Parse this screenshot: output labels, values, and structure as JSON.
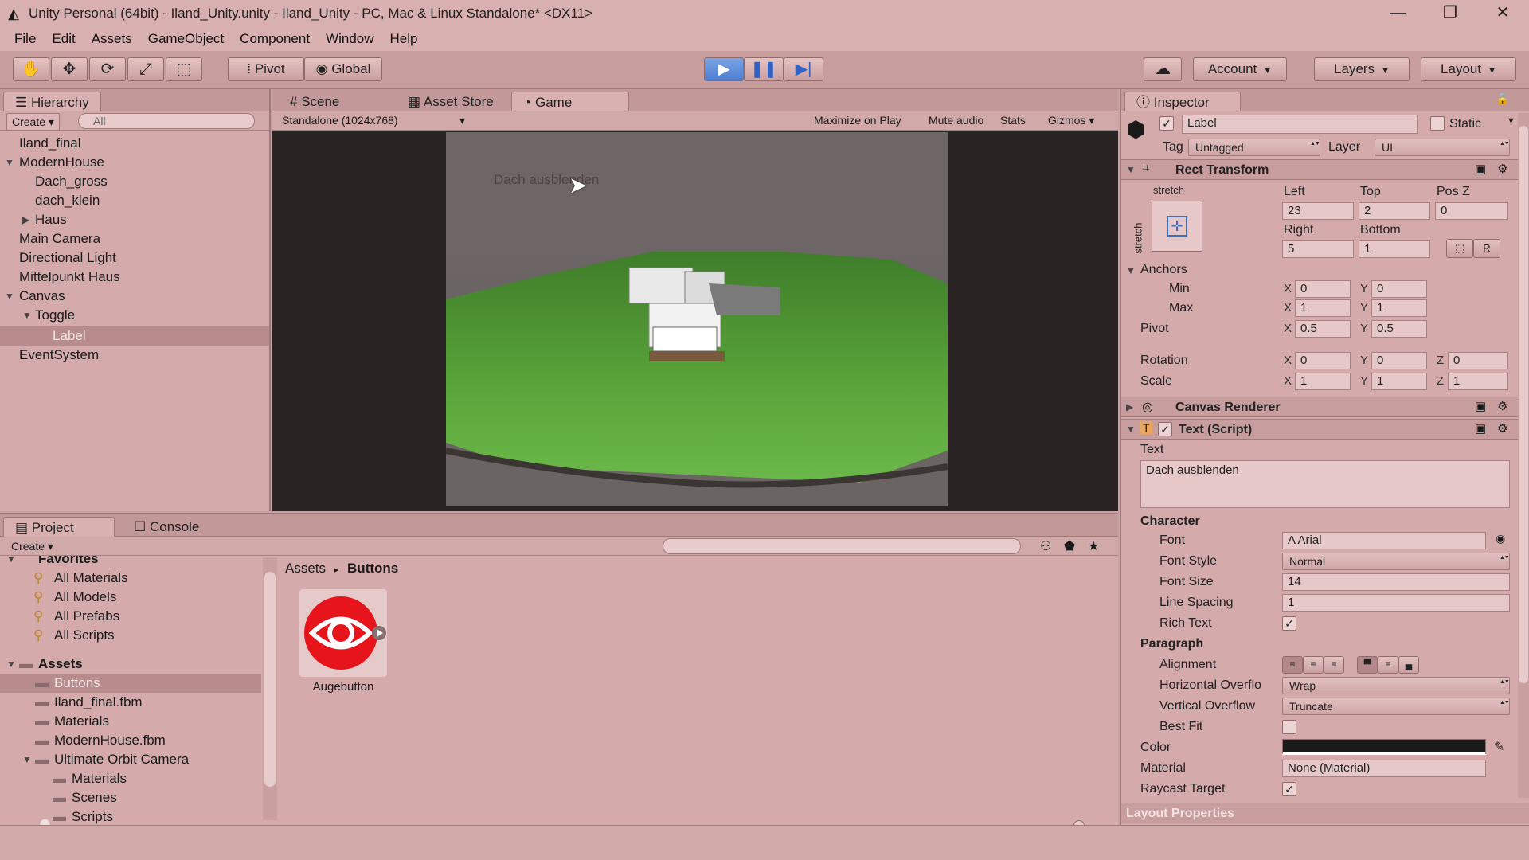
{
  "window": {
    "title": "Unity Personal (64bit) - Iland_Unity.unity - Iland_Unity - PC, Mac & Linux Standalone* <DX11>",
    "minimize": "—",
    "maximize": "❐",
    "close": "✕"
  },
  "menu": [
    "File",
    "Edit",
    "Assets",
    "GameObject",
    "Component",
    "Window",
    "Help"
  ],
  "toolbar": {
    "pivot": "Pivot",
    "global": "Global",
    "account": "Account",
    "layers": "Layers",
    "layout": "Layout"
  },
  "hierarchy": {
    "tab": "Hierarchy",
    "create": "Create",
    "search_placeholder": "All",
    "items": [
      {
        "label": "Iland_final"
      },
      {
        "label": "ModernHouse"
      },
      {
        "label": "Dach_gross"
      },
      {
        "label": "dach_klein"
      },
      {
        "label": "Haus"
      },
      {
        "label": "Main Camera"
      },
      {
        "label": "Directional Light"
      },
      {
        "label": "Mittelpunkt Haus"
      },
      {
        "label": "Canvas"
      },
      {
        "label": "Toggle"
      },
      {
        "label": "Label"
      },
      {
        "label": "EventSystem"
      }
    ]
  },
  "center": {
    "tabs": [
      "Scene",
      "Asset Store",
      "Game"
    ],
    "resolution": "Standalone (1024x768)",
    "maximize_on_play": "Maximize on Play",
    "mute_audio": "Mute audio",
    "stats": "Stats",
    "gizmos": "Gizmos",
    "game_text": "Dach ausblenden"
  },
  "project": {
    "tabs": [
      "Project",
      "Console"
    ],
    "create": "Create",
    "favorites_label": "Favorites",
    "favorites": [
      "All Materials",
      "All Models",
      "All Prefabs",
      "All Scripts"
    ],
    "assets_label": "Assets",
    "assets": [
      "Buttons",
      "Iland_final.fbm",
      "Materials",
      "ModernHouse.fbm",
      "Ultimate Orbit Camera",
      "Materials",
      "Scenes",
      "Scripts"
    ],
    "breadcrumb": [
      "Assets",
      "Buttons"
    ],
    "asset_item": "Augebutton"
  },
  "inspector": {
    "tab": "Inspector",
    "object_name": "Label",
    "static_label": "Static",
    "tag_label": "Tag",
    "tag_value": "Untagged",
    "layer_label": "Layer",
    "layer_value": "UI",
    "rect_transform": {
      "title": "Rect Transform",
      "stretch_top": "stretch",
      "stretch_side": "stretch",
      "left_label": "Left",
      "left": "23",
      "top_label": "Top",
      "top": "2",
      "posz_label": "Pos Z",
      "posz": "0",
      "right_label": "Right",
      "right": "5",
      "bottom_label": "Bottom",
      "bottom": "1",
      "r_button": "R",
      "anchors_label": "Anchors",
      "min_label": "Min",
      "min_x": "0",
      "min_y": "0",
      "max_label": "Max",
      "max_x": "1",
      "max_y": "1",
      "pivot_label": "Pivot",
      "pivot_x": "0.5",
      "pivot_y": "0.5",
      "rotation_label": "Rotation",
      "rot_x": "0",
      "rot_y": "0",
      "rot_z": "0",
      "scale_label": "Scale",
      "scale_x": "1",
      "scale_y": "1",
      "scale_z": "1"
    },
    "canvas_renderer": "Canvas Renderer",
    "text_script": {
      "title": "Text (Script)",
      "text_label": "Text",
      "text_value": "Dach ausblenden",
      "character_label": "Character",
      "font_label": "Font",
      "font_value": "Arial",
      "font_style_label": "Font Style",
      "font_style_value": "Normal",
      "font_size_label": "Font Size",
      "font_size_value": "14",
      "line_spacing_label": "Line Spacing",
      "line_spacing_value": "1",
      "rich_text_label": "Rich Text",
      "paragraph_label": "Paragraph",
      "alignment_label": "Alignment",
      "h_overflow_label": "Horizontal Overflo",
      "h_overflow_value": "Wrap",
      "v_overflow_label": "Vertical Overflow",
      "v_overflow_value": "Truncate",
      "best_fit_label": "Best Fit",
      "color_label": "Color",
      "material_label": "Material",
      "material_value": "None (Material)",
      "raycast_label": "Raycast Target"
    },
    "layout_properties": "Layout Properties"
  },
  "colors": {
    "panel": "#d4aaaa",
    "play_active": "#4f7ed0",
    "eye_button": "#e8141c"
  }
}
